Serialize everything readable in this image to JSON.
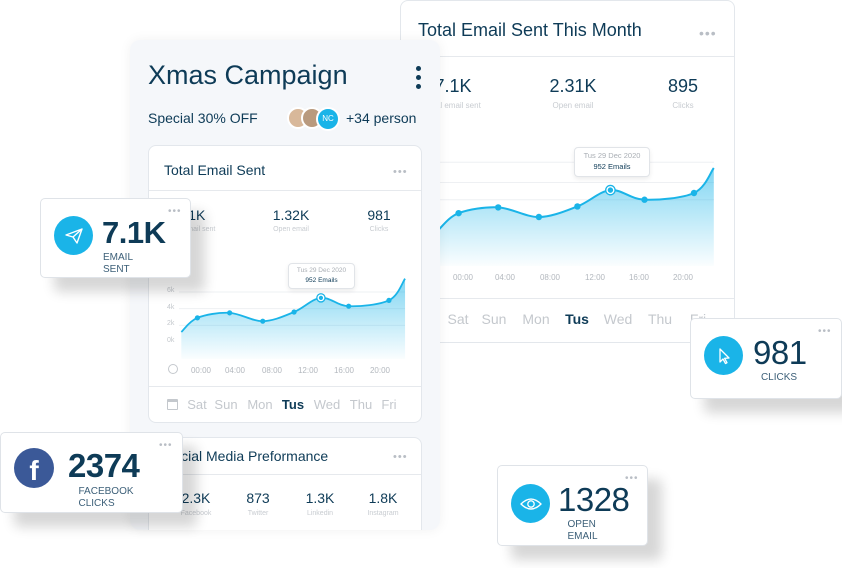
{
  "colors": {
    "accent": "#1ab4e8",
    "text": "#0e3b57",
    "facebook": "#3b5998"
  },
  "monthly_card": {
    "title": "Total Email Sent This Month",
    "menu_icon": "more-horizontal-icon",
    "stats": [
      {
        "value": "7.1K",
        "label": "Total email sent"
      },
      {
        "value": "2.31K",
        "label": "Open email"
      },
      {
        "value": "895",
        "label": "Clicks"
      }
    ],
    "tooltip": {
      "date": "Tus 29 Dec 2020",
      "value": "952 Emails"
    },
    "times": [
      "00:00",
      "04:00",
      "08:00",
      "12:00",
      "16:00",
      "20:00"
    ],
    "days": [
      "Sat",
      "Sun",
      "Mon",
      "Tus",
      "Wed",
      "Thu",
      "Fri"
    ],
    "active_day": "Tus"
  },
  "campaign": {
    "title": "Xmas Campaign",
    "menu_icon": "more-vertical-icon",
    "subtitle": "Special 30% OFF",
    "avatar_initials": "NC",
    "people": "+34 person",
    "email_card": {
      "title": "Total Email Sent",
      "stats": [
        {
          "value": "7.1K",
          "label": "Total email sent"
        },
        {
          "value": "1.32K",
          "label": "Open email"
        },
        {
          "value": "981",
          "label": "Clicks"
        }
      ],
      "tooltip": {
        "date": "Tus 29 Dec 2020",
        "value": "952 Emails"
      },
      "times": [
        "00:00",
        "04:00",
        "08:00",
        "12:00",
        "16:00",
        "20:00"
      ],
      "days": [
        "Sat",
        "Sun",
        "Mon",
        "Tus",
        "Wed",
        "Thu",
        "Fri"
      ],
      "active_day": "Tus"
    },
    "social_card": {
      "title": "Social Media Preformance",
      "stats": [
        {
          "value": "2.3K",
          "label": "Facebook"
        },
        {
          "value": "873",
          "label": "Twitter"
        },
        {
          "value": "1.3K",
          "label": "Linkedin"
        },
        {
          "value": "1.8K",
          "label": "Instagram"
        }
      ]
    }
  },
  "widgets": {
    "email_sent": {
      "value": "7.1K",
      "label": "EMAIL SENT",
      "icon": "paper-plane-icon"
    },
    "facebook": {
      "value": "2374",
      "label": "FACEBOOK CLICKS",
      "icon": "facebook-icon"
    },
    "clicks": {
      "value": "981",
      "label": "CLICKS",
      "icon": "cursor-icon"
    },
    "open_email": {
      "value": "1328",
      "label": "OPEN EMAIL",
      "icon": "eye-icon"
    }
  },
  "chart_data": {
    "type": "area",
    "xlabel": "",
    "ylabel": "",
    "y_ticks": [
      "0k",
      "2k",
      "4k",
      "6k"
    ],
    "ylim": [
      0,
      6
    ],
    "x_ticks": [
      "00:00",
      "04:00",
      "08:00",
      "12:00",
      "16:00",
      "20:00"
    ],
    "x": [
      -2.2,
      -0.4,
      3.2,
      6.9,
      10.4,
      13.4,
      16.5,
      21,
      22.8
    ],
    "values": [
      1.2,
      2.9,
      3.5,
      2.5,
      3.6,
      5.3,
      4.3,
      5.0,
      7.6
    ],
    "highlight_index": 5,
    "grid": true
  }
}
